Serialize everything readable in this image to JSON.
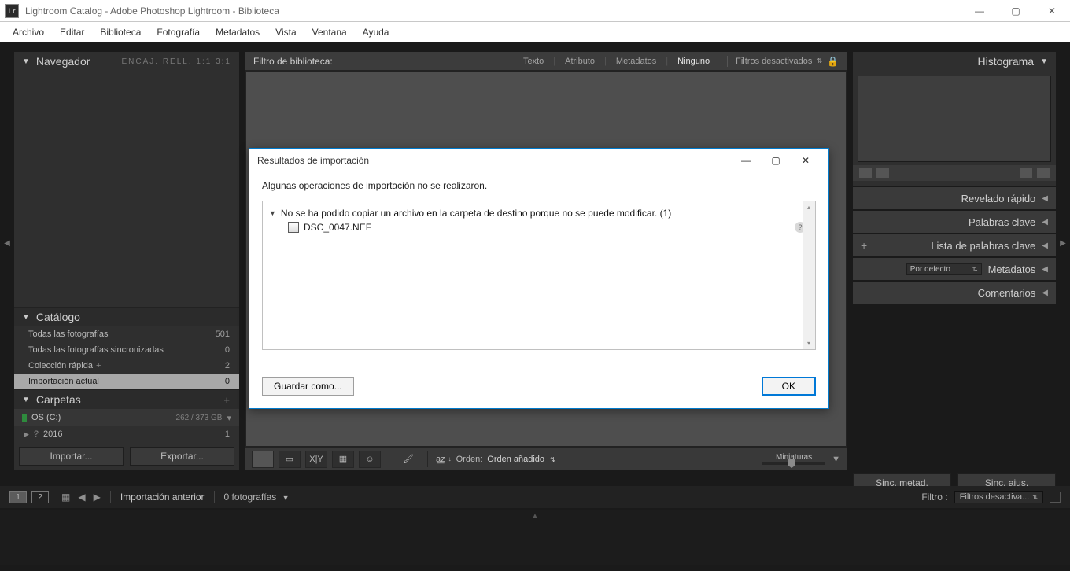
{
  "titlebar": {
    "logo": "Lr",
    "title": "Lightroom Catalog - Adobe Photoshop Lightroom - Biblioteca"
  },
  "menu": [
    "Archivo",
    "Editar",
    "Biblioteca",
    "Fotografía",
    "Metadatos",
    "Vista",
    "Ventana",
    "Ayuda"
  ],
  "left": {
    "navegador": {
      "title": "Navegador",
      "extras": "ENCAJ.   RELL.   1:1   3:1"
    },
    "catalogo": {
      "title": "Catálogo",
      "items": [
        {
          "label": "Todas las fotografías",
          "count": "501"
        },
        {
          "label": "Todas las fotografías sincronizadas",
          "count": "0"
        },
        {
          "label": "Colección rápida",
          "count": "2",
          "plus": "+"
        },
        {
          "label": "Importación actual",
          "count": "0",
          "selected": true
        }
      ]
    },
    "carpetas": {
      "title": "Carpetas",
      "plus": "+",
      "volume": {
        "name": "OS (C:)",
        "size": "262 / 373 GB"
      },
      "rows": [
        {
          "year": "2016",
          "count": "1",
          "q": "?"
        }
      ]
    },
    "buttons": {
      "import": "Importar...",
      "export": "Exportar..."
    }
  },
  "center": {
    "filter": {
      "title": "Filtro de biblioteca:",
      "tabs": [
        "Texto",
        "Atributo",
        "Metadatos",
        "Ninguno"
      ],
      "active": "Ninguno",
      "state": "Filtros desactivados"
    },
    "toolbar": {
      "order_label": "Orden:",
      "order_value": "Orden añadido",
      "thumbs": "Miniaturas"
    }
  },
  "right": {
    "histograma": "Histograma",
    "rows": [
      {
        "label": "Revelado rápido"
      },
      {
        "label": "Palabras clave"
      },
      {
        "label": "Lista de palabras clave",
        "plus": true
      },
      {
        "label": "Metadatos",
        "dd": "Por defecto"
      },
      {
        "label": "Comentarios"
      }
    ],
    "sync": {
      "meta": "Sinc. metad.",
      "adj": "Sinc. ajus."
    }
  },
  "status": {
    "pages": [
      "1",
      "2"
    ],
    "left_label": "Importación anterior",
    "count_label": "0 fotografías",
    "filter_label": "Filtro :",
    "filter_value": "Filtros desactiva..."
  },
  "modal": {
    "title": "Resultados de importación",
    "message": "Algunas operaciones de importación no se realizaron.",
    "group": "No se ha podido copiar un archivo en la carpeta de destino porque no se puede modificar. (1)",
    "file": "DSC_0047.NEF",
    "save": "Guardar como...",
    "ok": "OK"
  }
}
